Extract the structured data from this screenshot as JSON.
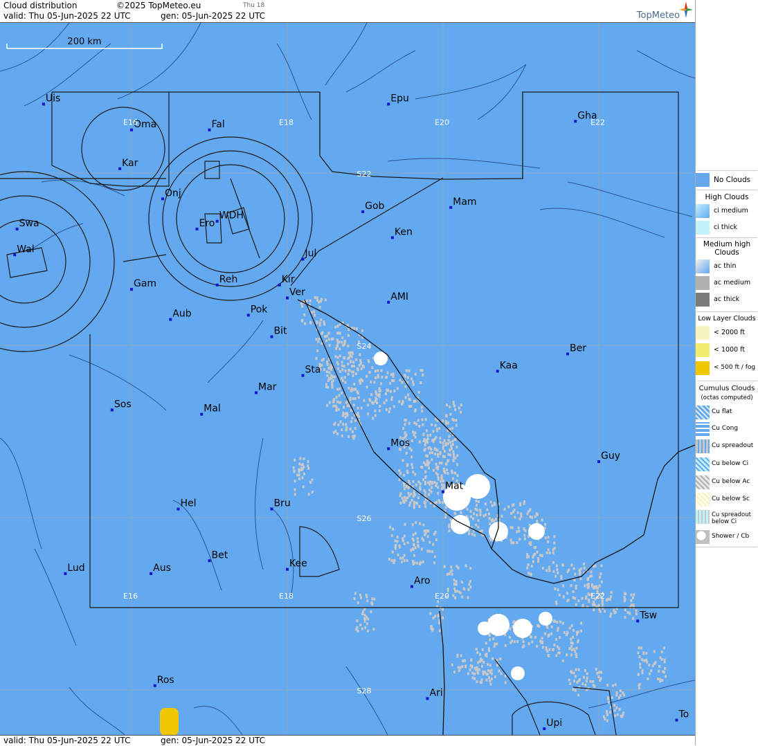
{
  "header": {
    "title": "Cloud distribution",
    "copyright": "©2025 TopMeteo.eu",
    "day_badge": "Thu 18",
    "valid_line": "valid:  Thu  05-Jun-2025  22 UTC",
    "gen_line": "gen: 05-Jun-2025 22 UTC",
    "logo_text": "TopMeteo"
  },
  "footer": {
    "valid_line": "valid:  Thu  05-Jun-2025  22 UTC",
    "gen_line": "gen: 05-Jun-2025 22 UTC"
  },
  "map": {
    "scale_label": "200 km",
    "colors": {
      "sea_land": "#63a9f0",
      "grid": "#8aa6c4",
      "line": "#1a1a1a",
      "town": "#1515d0",
      "cloud": "#c8c8c8",
      "fog": "#f0c800"
    },
    "grid_labels": [
      {
        "text": "E16",
        "lon": 16,
        "lat": -21.4
      },
      {
        "text": "E18",
        "lon": 18,
        "lat": -21.4
      },
      {
        "text": "E20",
        "lon": 20,
        "lat": -21.4
      },
      {
        "text": "E22",
        "lon": 22,
        "lat": -21.4
      },
      {
        "text": "S22",
        "lon": 19.0,
        "lat": -22
      },
      {
        "text": "S24",
        "lon": 19.0,
        "lat": -24
      },
      {
        "text": "S26",
        "lon": 19.0,
        "lat": -26
      },
      {
        "text": "S28",
        "lon": 19.0,
        "lat": -28
      },
      {
        "text": "E16",
        "lon": 16,
        "lat": -26.9
      },
      {
        "text": "E18",
        "lon": 18,
        "lat": -26.9
      },
      {
        "text": "E20",
        "lon": 20,
        "lat": -26.9
      },
      {
        "text": "E22",
        "lon": 22,
        "lat": -26.9
      }
    ],
    "towns": [
      {
        "name": "Uis",
        "lon": 14.87,
        "lat": -21.2
      },
      {
        "name": "Fal",
        "lon": 17.0,
        "lat": -21.5
      },
      {
        "name": "Oma",
        "lon": 16.0,
        "lat": -21.5
      },
      {
        "name": "Epu",
        "lon": 19.3,
        "lat": -21.2
      },
      {
        "name": "Gha",
        "lon": 21.7,
        "lat": -21.4
      },
      {
        "name": "Kar",
        "lon": 15.85,
        "lat": -21.95
      },
      {
        "name": "Onj",
        "lon": 16.4,
        "lat": -22.3
      },
      {
        "name": "Mam",
        "lon": 20.1,
        "lat": -22.4
      },
      {
        "name": "Swa",
        "lon": 14.53,
        "lat": -22.65
      },
      {
        "name": "WDH",
        "lon": 17.1,
        "lat": -22.56
      },
      {
        "name": "Ero",
        "lon": 16.84,
        "lat": -22.65
      },
      {
        "name": "Gob",
        "lon": 18.97,
        "lat": -22.45
      },
      {
        "name": "Ken",
        "lon": 19.35,
        "lat": -22.75
      },
      {
        "name": "Wal",
        "lon": 14.5,
        "lat": -22.95
      },
      {
        "name": "Jul",
        "lon": 18.2,
        "lat": -23.0
      },
      {
        "name": "Gam",
        "lon": 16.0,
        "lat": -23.35
      },
      {
        "name": "Reh",
        "lon": 17.1,
        "lat": -23.3
      },
      {
        "name": "Kir",
        "lon": 17.9,
        "lat": -23.3
      },
      {
        "name": "Ver",
        "lon": 18.0,
        "lat": -23.45
      },
      {
        "name": "Pok",
        "lon": 17.5,
        "lat": -23.65
      },
      {
        "name": "AMI",
        "lon": 19.3,
        "lat": -23.5
      },
      {
        "name": "Aub",
        "lon": 16.5,
        "lat": -23.7
      },
      {
        "name": "Bit",
        "lon": 17.8,
        "lat": -23.9
      },
      {
        "name": "Ber",
        "lon": 21.6,
        "lat": -24.1
      },
      {
        "name": "Sta",
        "lon": 18.2,
        "lat": -24.35
      },
      {
        "name": "Kaa",
        "lon": 20.7,
        "lat": -24.3
      },
      {
        "name": "Mar",
        "lon": 17.6,
        "lat": -24.55
      },
      {
        "name": "Sos",
        "lon": 15.75,
        "lat": -24.75
      },
      {
        "name": "Mal",
        "lon": 16.9,
        "lat": -24.8
      },
      {
        "name": "Mos",
        "lon": 19.3,
        "lat": -25.2
      },
      {
        "name": "Guy",
        "lon": 22.0,
        "lat": -25.35
      },
      {
        "name": "Mat",
        "lon": 20.0,
        "lat": -25.7
      },
      {
        "name": "Hel",
        "lon": 16.6,
        "lat": -25.9
      },
      {
        "name": "Bru",
        "lon": 17.8,
        "lat": -25.9
      },
      {
        "name": "Bet",
        "lon": 17.0,
        "lat": -26.5
      },
      {
        "name": "Kee",
        "lon": 18.0,
        "lat": -26.6
      },
      {
        "name": "Lud",
        "lon": 15.15,
        "lat": -26.65
      },
      {
        "name": "Aus",
        "lon": 16.25,
        "lat": -26.65
      },
      {
        "name": "Aro",
        "lon": 19.6,
        "lat": -26.8
      },
      {
        "name": "Tsw",
        "lon": 22.5,
        "lat": -27.2
      },
      {
        "name": "Ros",
        "lon": 16.3,
        "lat": -27.95
      },
      {
        "name": "Ari",
        "lon": 19.8,
        "lat": -28.1
      },
      {
        "name": "Upi",
        "lon": 21.3,
        "lat": -28.45
      },
      {
        "name": "To",
        "lon": 23.0,
        "lat": -28.35
      }
    ]
  },
  "legend": {
    "no_clouds": "No Clouds",
    "high_header": "High Clouds",
    "high": [
      "ci medium",
      "ci thick"
    ],
    "medium_header": "Medium high Clouds",
    "medium": [
      "ac thin",
      "ac medium",
      "ac thick"
    ],
    "low_header": "Low Layer Clouds",
    "low": [
      "< 2000 ft",
      "< 1000 ft",
      "< 500 ft / fog"
    ],
    "cu_header": "Cumulus Clouds",
    "cu_sub": "(octas computed)",
    "cu": [
      "Cu flat",
      "Cu Cong",
      "Cu spreadout",
      "Cu below Ci",
      "Cu below Ac",
      "Cu below Sc",
      "Cu spreadout below Ci",
      "Shower / Cb"
    ]
  }
}
